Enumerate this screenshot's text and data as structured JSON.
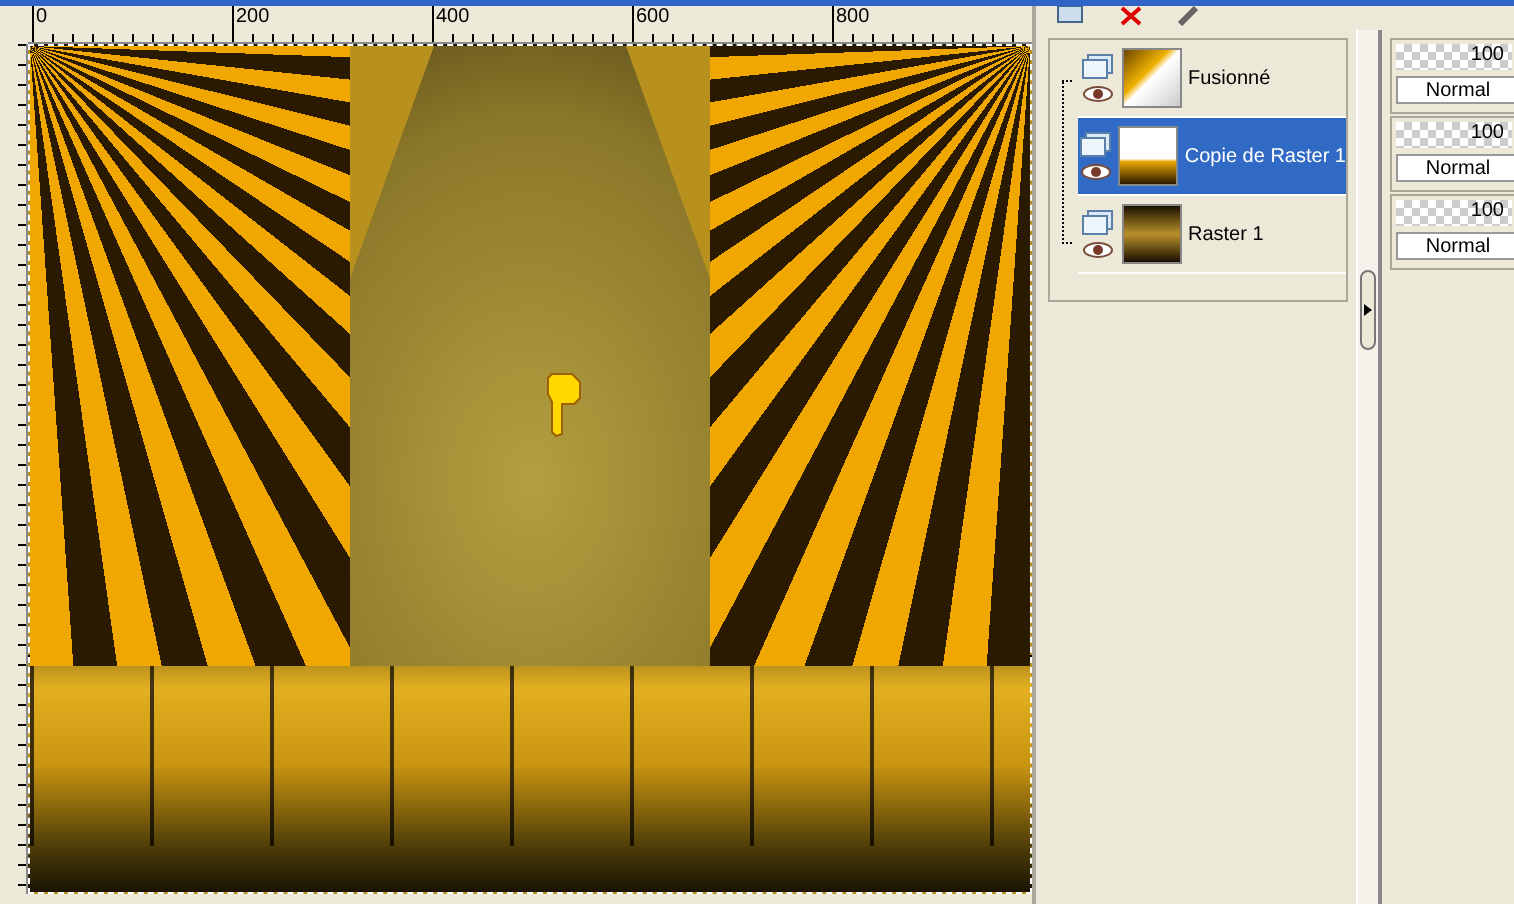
{
  "ruler": {
    "labels": [
      "0",
      "200",
      "400",
      "600",
      "800"
    ]
  },
  "layers": [
    {
      "name": "Fusionné",
      "selected": false,
      "visible": true,
      "kind": "merged",
      "opacity": "100",
      "blend": "Normal"
    },
    {
      "name": "Copie de Raster 1",
      "selected": true,
      "visible": true,
      "kind": "floor",
      "opacity": "100",
      "blend": "Normal"
    },
    {
      "name": "Raster 1",
      "selected": false,
      "visible": true,
      "kind": "gradient",
      "opacity": "100",
      "blend": "Normal"
    }
  ]
}
